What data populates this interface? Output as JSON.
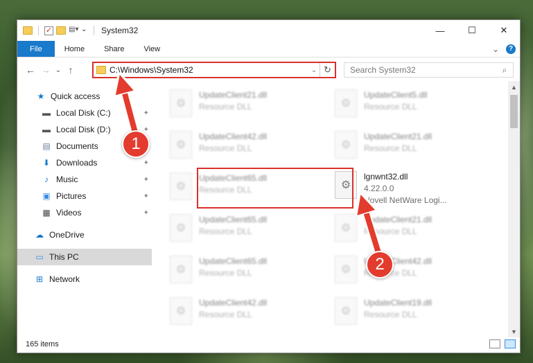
{
  "window": {
    "title": "System32",
    "controls": {
      "minimize": "—",
      "maximize": "☐",
      "close": "✕"
    }
  },
  "ribbon": {
    "tabs": [
      "File",
      "Home",
      "Share",
      "View"
    ],
    "collapse_glyph": "⌄",
    "help_glyph": "?"
  },
  "nav": {
    "back_glyph": "←",
    "forward_glyph": "→",
    "recent_glyph": "⌄",
    "up_glyph": "↑",
    "address": "C:\\Windows\\System32",
    "address_dropdown_glyph": "⌄",
    "refresh_glyph": "↻",
    "search_placeholder": "Search System32",
    "search_glyph": "⌕"
  },
  "sidebar": {
    "items": [
      {
        "label": "Quick access",
        "icon": "star-icon",
        "glyph": "★",
        "color": "#1979ca"
      },
      {
        "label": "Local Disk (C:)",
        "icon": "drive-icon",
        "glyph": "▬",
        "color": "#555555",
        "pinned": true
      },
      {
        "label": "Local Disk (D:)",
        "icon": "drive-icon",
        "glyph": "▬",
        "color": "#555555",
        "pinned": true
      },
      {
        "label": "Documents",
        "icon": "documents-icon",
        "glyph": "▤",
        "color": "#6a7f9a",
        "pinned": true
      },
      {
        "label": "Downloads",
        "icon": "download-icon",
        "glyph": "⬇",
        "color": "#1979ca",
        "pinned": true
      },
      {
        "label": "Music",
        "icon": "music-icon",
        "glyph": "♪",
        "color": "#1979ca",
        "pinned": true
      },
      {
        "label": "Pictures",
        "icon": "pictures-icon",
        "glyph": "▣",
        "color": "#3a8ee6",
        "pinned": true
      },
      {
        "label": "Videos",
        "icon": "videos-icon",
        "glyph": "▦",
        "color": "#444444",
        "pinned": true
      },
      {
        "label": "OneDrive",
        "icon": "cloud-icon",
        "glyph": "☁",
        "color": "#1979ca"
      },
      {
        "label": "This PC",
        "icon": "computer-icon",
        "glyph": "▭",
        "color": "#3a8ee6"
      },
      {
        "label": "Network",
        "icon": "network-icon",
        "glyph": "⊞",
        "color": "#1979ca"
      }
    ],
    "pin_glyph": "✦"
  },
  "files": [
    {
      "name": "UpdateClient21.dll",
      "sub": "Resource DLL"
    },
    {
      "name": "UpdateClient5.dll",
      "sub": "Resource DLL"
    },
    {
      "name": "UpdateClient42.dll",
      "sub": "Resource DLL"
    },
    {
      "name": "UpdateClient21.dll",
      "sub": "Resource DLL"
    },
    {
      "name": "UpdateClient65.dll",
      "sub": "Resource DLL"
    },
    {
      "name": "lgnwnt32.dll",
      "version": "4.22.0.0",
      "sub": "Novell NetWare Logi...",
      "highlighted": true
    },
    {
      "name": "UpdateClient65.dll",
      "sub": "Resource DLL"
    },
    {
      "name": "UpdateClient21.dll",
      "sub": "Resource DLL"
    },
    {
      "name": "UpdateClient65.dll",
      "sub": "Resource DLL"
    },
    {
      "name": "UpdateClient42.dll",
      "sub": "Resource DLL"
    },
    {
      "name": "UpdateClient42.dll",
      "sub": "Resource DLL"
    },
    {
      "name": "UpdateClient19.dll",
      "sub": "Resource DLL"
    }
  ],
  "file_icon_glyph": "⚙",
  "scrollbar": {
    "up_glyph": "▲",
    "down_glyph": "▼"
  },
  "status": {
    "count": "165 items"
  },
  "annotations": {
    "badge1": "1",
    "badge2": "2",
    "color": "#e33b2e"
  }
}
